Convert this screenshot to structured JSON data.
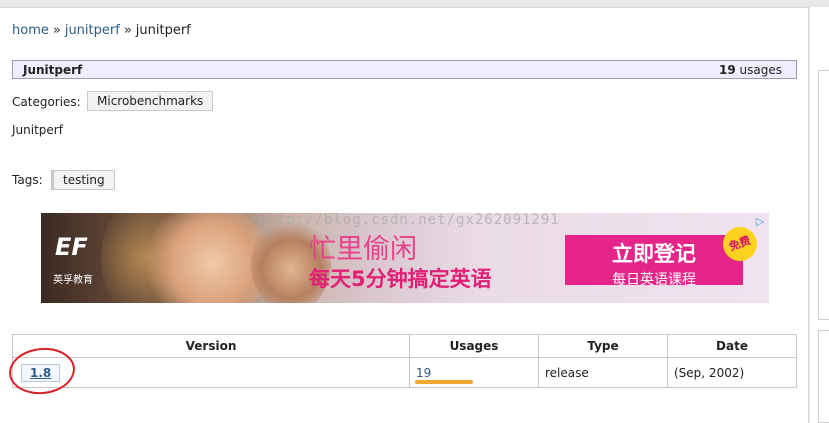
{
  "breadcrumb": {
    "home": "home",
    "sep1": "»",
    "group": "junitperf",
    "sep2": "»",
    "artifact": "junitperf"
  },
  "artifact": {
    "title": "Junitperf",
    "usages_count": "19",
    "usages_label": "usages",
    "categories_label": "Categories:",
    "category": "Microbenchmarks",
    "description": "Junitperf",
    "tags_label": "Tags:",
    "tag": "testing"
  },
  "ad": {
    "logo": "EF",
    "logo_sub": "英孚教育",
    "headline1": "忙里偷闲",
    "headline2": "每天5分钟搞定英语",
    "cta_line1": "立即登记",
    "cta_line2": "每日英语课程",
    "badge": "免费",
    "adchoices_icon": "▷"
  },
  "watermark": "http://blog.csdn.net/gx262091291",
  "table": {
    "headers": [
      "Version",
      "Usages",
      "Type",
      "Date"
    ],
    "rows": [
      {
        "version": "1.8",
        "usages": "19",
        "type": "release",
        "date": "(Sep, 2002)"
      }
    ]
  },
  "colors": {
    "link": "#2e5d8a",
    "title_bar_bg": "#eeeefe",
    "annotation_red": "#d9232a",
    "annotation_orange": "#f0a830",
    "ad_pink": "#e5258a"
  }
}
